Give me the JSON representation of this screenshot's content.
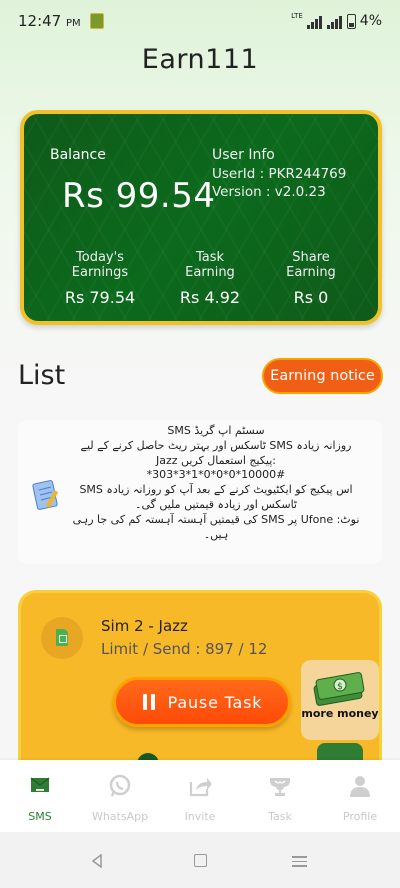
{
  "status_bar": {
    "time": "12:47",
    "ampm": "PM",
    "network": "LTE",
    "battery": "4%"
  },
  "app": {
    "title": "Earn111"
  },
  "balance": {
    "label": "Balance",
    "value": "Rs 99.54",
    "user_info_title": "User Info",
    "user_id": "UserId : PKR244769",
    "version": "Version : v2.0.23",
    "stats": [
      {
        "label": "Today's Earnings",
        "value": "Rs 79.54"
      },
      {
        "label": "Task Earning",
        "value": "Rs 4.92"
      },
      {
        "label": "Share Earning",
        "value": "Rs 0"
      }
    ]
  },
  "list": {
    "title": "List",
    "notice_button": "Earning notice"
  },
  "notice": {
    "lines": [
      "سسٹم اپ گریڈ SMS",
      "روزانہ زیادہ SMS ٹاسکس اور بہتر ریٹ حاصل کرنے کے لیے",
      "Jazz پیکیج استعمال کریں:",
      "*303*3*1*0*0*0*10000#",
      "اس پیکیج کو ایکٹیویٹ کرنے کے بعد آپ کو روزانہ زیادہ SMS",
      "ٹاسکس اور زیادہ قیمتیں ملیں گی۔",
      "نوٹ: Ufone پر SMS کی قیمتیں آہستہ آہستہ کم کی جا رہی",
      "ہیں۔"
    ]
  },
  "task": {
    "sim_name": "Sim 2 - Jazz",
    "limit_text": "Limit / Send : 897 / 12",
    "pause_label": "Pause Task",
    "more_money_label": "more money"
  },
  "bottom_nav": {
    "items": [
      {
        "label": "SMS",
        "icon": "sms-icon",
        "active": true
      },
      {
        "label": "WhatsApp",
        "icon": "whatsapp-icon",
        "active": false
      },
      {
        "label": "Invite",
        "icon": "share-icon",
        "active": false
      },
      {
        "label": "Task",
        "icon": "trophy-icon",
        "active": false
      },
      {
        "label": "Profile",
        "icon": "person-icon",
        "active": false
      }
    ]
  },
  "colors": {
    "card_green": "#0b6a1c",
    "card_border": "#f2c12a",
    "accent_orange": "#f15f17",
    "task_yellow": "#f8b928",
    "active_nav": "#2e7d32"
  }
}
